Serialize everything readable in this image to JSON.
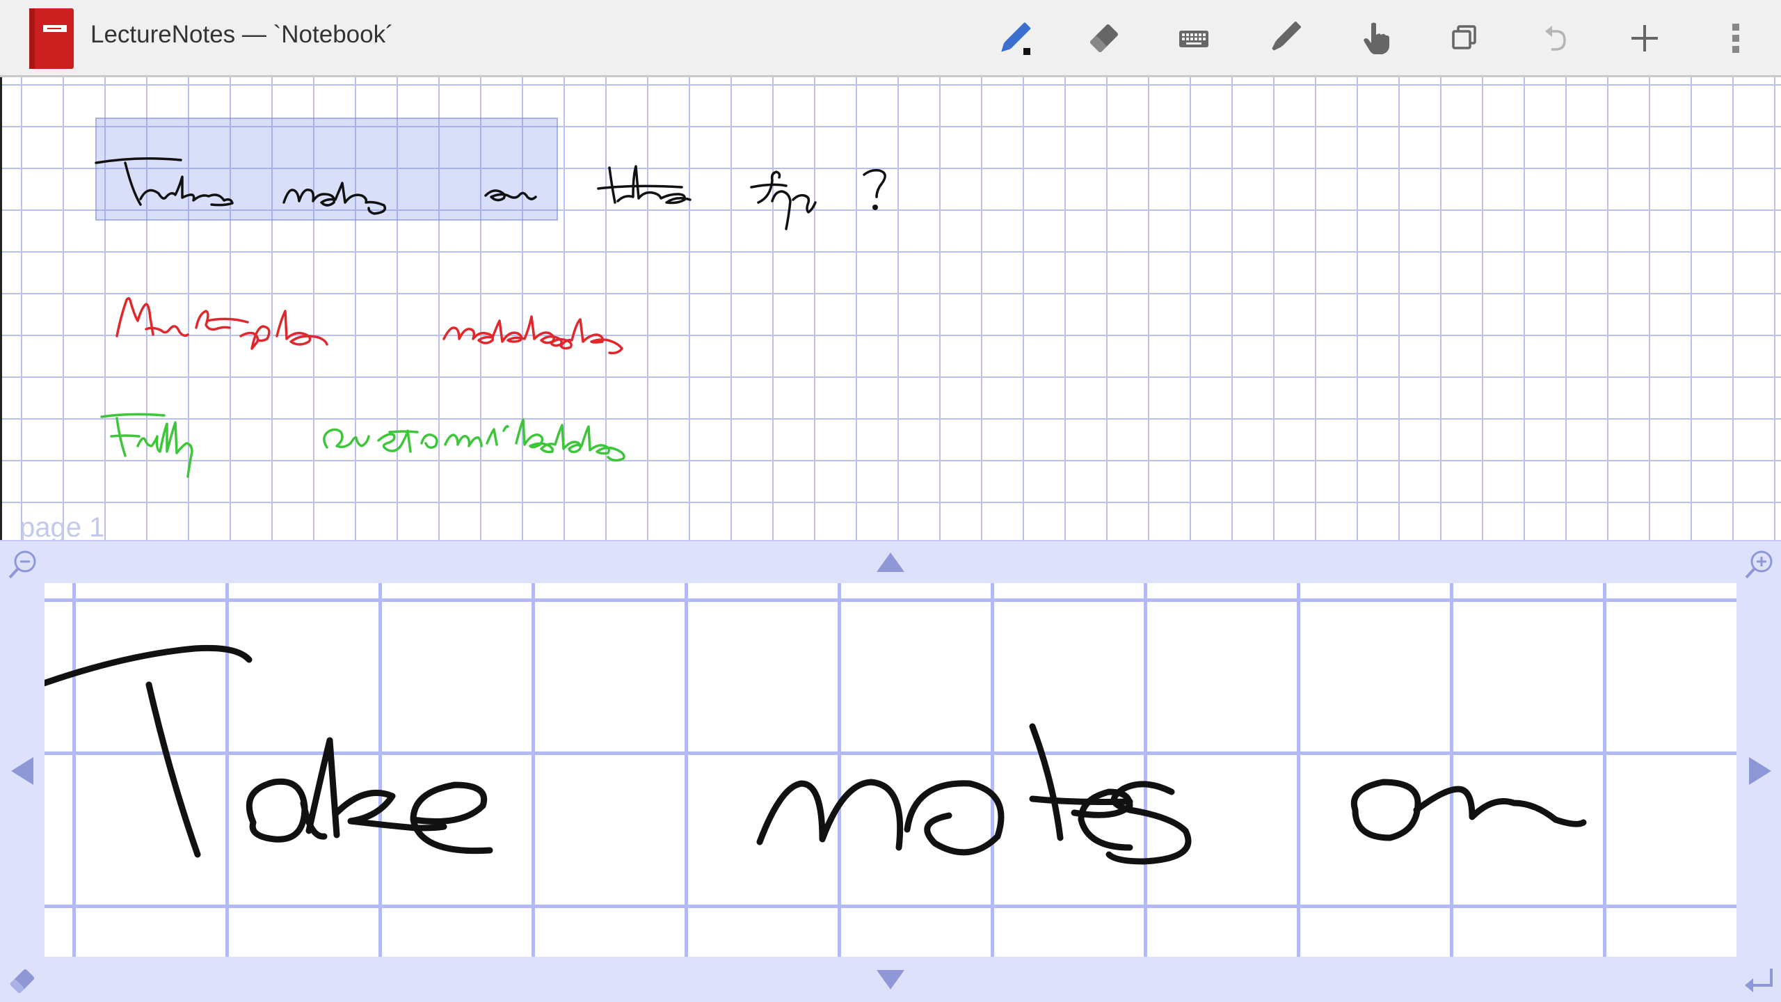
{
  "app": {
    "title": "LectureNotes — `Notebook´",
    "icon": "notebook-app-icon",
    "accent_color": "#cc1f1f"
  },
  "toolbar": {
    "buttons": [
      {
        "name": "pen-tool",
        "icon": "pen-icon",
        "active": true
      },
      {
        "name": "eraser-tool",
        "icon": "eraser-icon"
      },
      {
        "name": "keyboard-tool",
        "icon": "keyboard-icon"
      },
      {
        "name": "marker-tool",
        "icon": "marker-icon"
      },
      {
        "name": "hand-tool",
        "icon": "hand-pointer-icon"
      },
      {
        "name": "copy-tool",
        "icon": "copy-icon"
      },
      {
        "name": "undo",
        "icon": "undo-icon",
        "enabled": false
      },
      {
        "name": "add",
        "icon": "plus-icon"
      },
      {
        "name": "overflow-menu",
        "icon": "more-vertical-icon"
      }
    ]
  },
  "page": {
    "label": "page 1",
    "handwriting": [
      {
        "text": "Take notes on the fly!",
        "color": "#111111",
        "selected_portion": "Take notes on"
      },
      {
        "text": "Multiple notebooks",
        "color": "#e0282c"
      },
      {
        "text": "Fully customizable",
        "color": "#3ec63a"
      }
    ],
    "grid_color": "#b9bff0",
    "selection_color": "#8c9cec"
  },
  "input_panel": {
    "handwriting": {
      "text": "Take notes on",
      "color": "#111111"
    },
    "background_color": "#dde1fa",
    "buttons": [
      {
        "name": "zoom-out",
        "icon": "zoom-out-icon"
      },
      {
        "name": "zoom-in",
        "icon": "zoom-in-icon"
      },
      {
        "name": "scroll-up",
        "icon": "arrow-up-icon"
      },
      {
        "name": "scroll-down",
        "icon": "arrow-down-icon"
      },
      {
        "name": "scroll-left",
        "icon": "arrow-left-icon"
      },
      {
        "name": "scroll-right",
        "icon": "arrow-right-icon"
      },
      {
        "name": "eraser",
        "icon": "eraser-icon"
      },
      {
        "name": "return",
        "icon": "return-icon"
      }
    ]
  }
}
